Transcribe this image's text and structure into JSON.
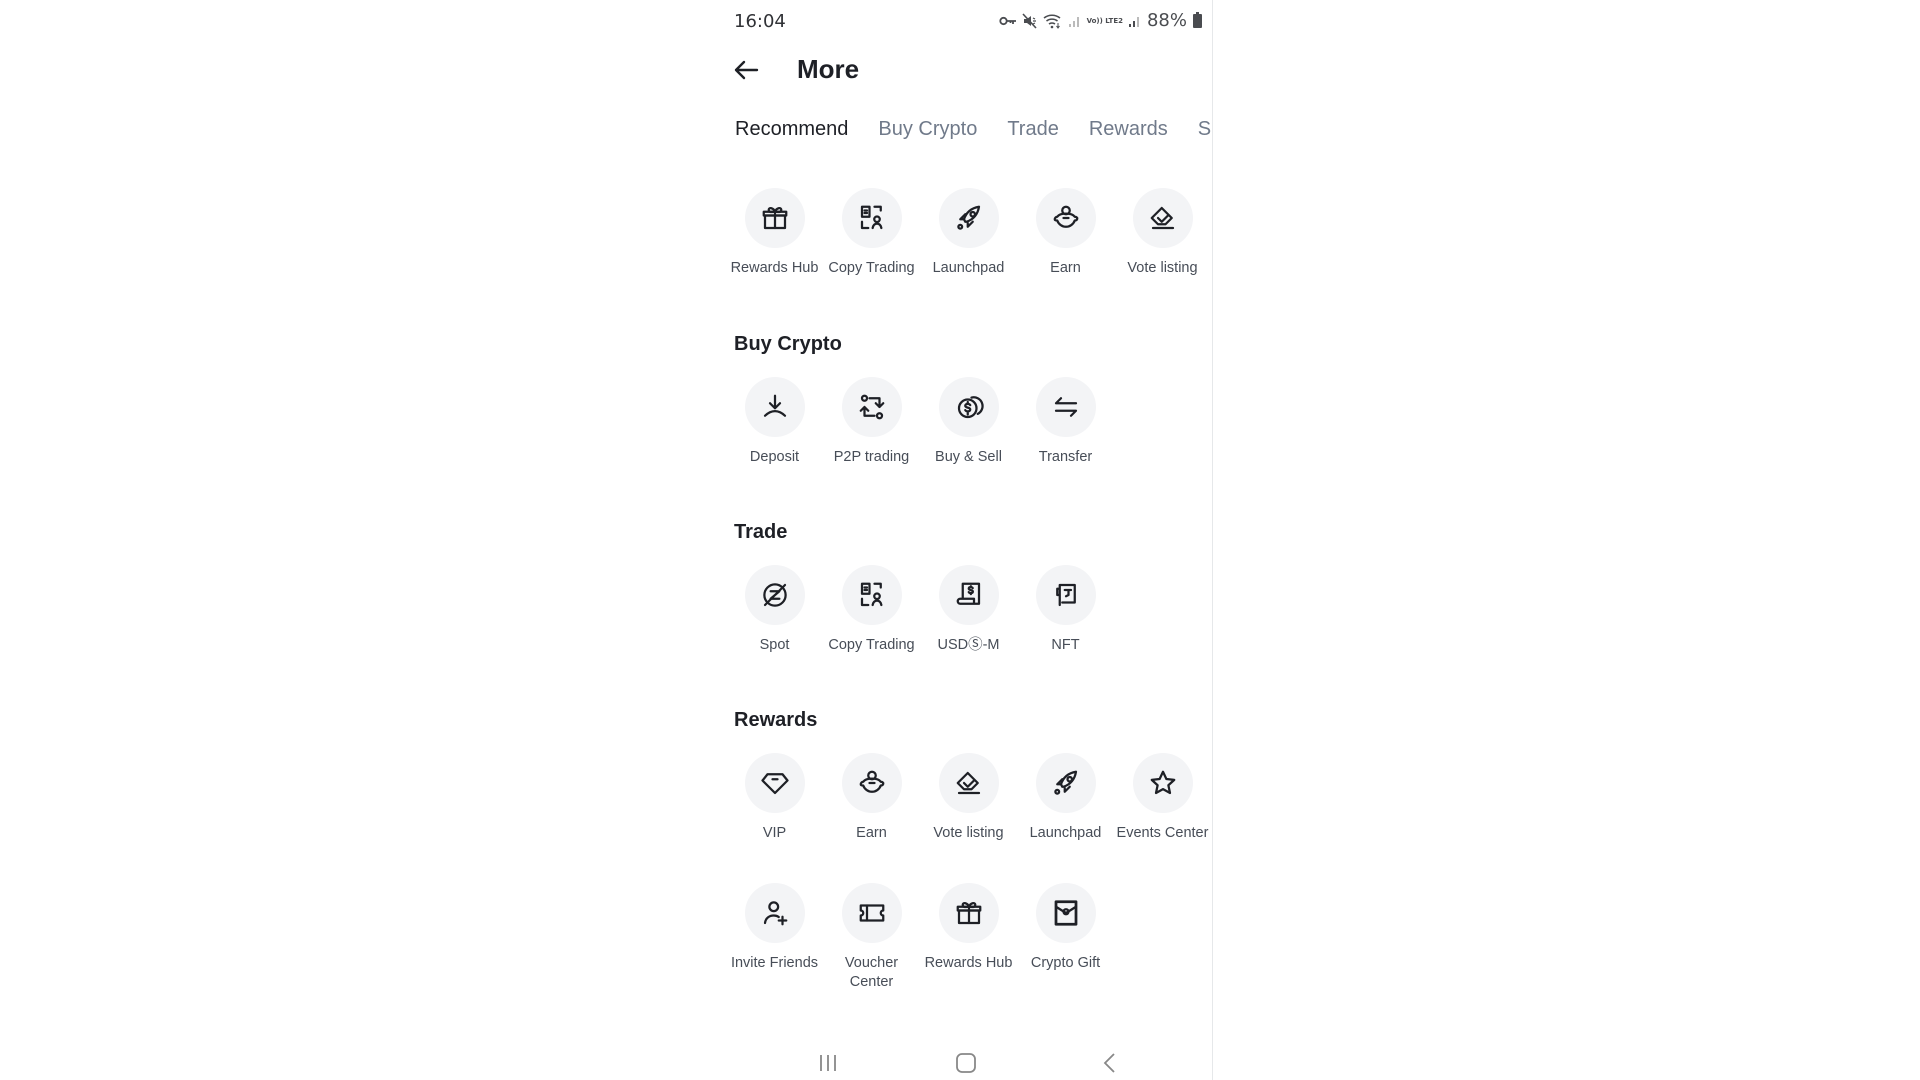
{
  "status_bar": {
    "time": "16:04",
    "icons": [
      "vpn-key-icon",
      "mute-icon",
      "wifi-icon",
      "signal-icon",
      "volte-lte2-icon",
      "signal-icon"
    ],
    "volte_text": "Vo)) LTE2",
    "battery": "88%"
  },
  "header": {
    "back_icon": "arrow-left-icon",
    "title": "More"
  },
  "tabs": [
    {
      "label": "Recommend",
      "active": true
    },
    {
      "label": "Buy Crypto",
      "active": false
    },
    {
      "label": "Trade",
      "active": false
    },
    {
      "label": "Rewards",
      "active": false
    },
    {
      "label": "Sup",
      "active": false
    }
  ],
  "sections": {
    "recommend": {
      "items": [
        {
          "label": "Rewards Hub",
          "icon": "gift-icon"
        },
        {
          "label": "Copy Trading",
          "icon": "copy-trading-icon"
        },
        {
          "label": "Launchpad",
          "icon": "rocket-icon"
        },
        {
          "label": "Earn",
          "icon": "piggy-bank-icon"
        },
        {
          "label": "Vote listing",
          "icon": "vote-icon"
        }
      ]
    },
    "buy_crypto": {
      "title": "Buy Crypto",
      "items": [
        {
          "label": "Deposit",
          "icon": "deposit-icon"
        },
        {
          "label": "P2P trading",
          "icon": "p2p-icon"
        },
        {
          "label": "Buy & Sell",
          "icon": "coins-icon"
        },
        {
          "label": "Transfer",
          "icon": "transfer-icon"
        }
      ]
    },
    "trade": {
      "title": "Trade",
      "items": [
        {
          "label": "Spot",
          "icon": "spot-icon"
        },
        {
          "label": "Copy Trading",
          "icon": "copy-trading-icon"
        },
        {
          "label": "USDⓈ-M",
          "icon": "futures-icon"
        },
        {
          "label": "NFT",
          "icon": "nft-icon"
        }
      ]
    },
    "rewards": {
      "title": "Rewards",
      "items": [
        {
          "label": "VIP",
          "icon": "diamond-icon"
        },
        {
          "label": "Earn",
          "icon": "piggy-bank-icon"
        },
        {
          "label": "Vote listing",
          "icon": "vote-icon"
        },
        {
          "label": "Launchpad",
          "icon": "rocket-icon"
        },
        {
          "label": "Events Center",
          "icon": "star-icon"
        },
        {
          "label": "Invite Friends",
          "icon": "add-user-icon"
        },
        {
          "label": "Voucher Center",
          "icon": "ticket-icon"
        },
        {
          "label": "Rewards Hub",
          "icon": "gift-icon"
        },
        {
          "label": "Crypto Gift",
          "icon": "envelope-icon"
        }
      ]
    }
  },
  "navbar": {
    "recent_icon": "recent-apps-icon",
    "home_icon": "home-icon",
    "back_icon": "back-chevron-icon"
  }
}
